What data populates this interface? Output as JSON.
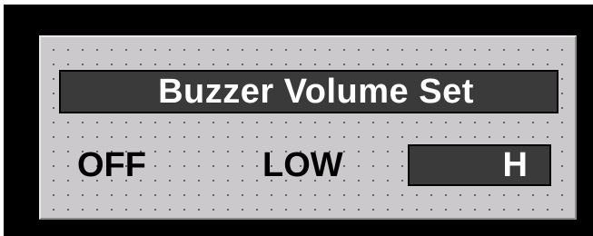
{
  "panel": {
    "title": "Buzzer Volume Set"
  },
  "options": [
    {
      "label": "OFF",
      "selected": false
    },
    {
      "label": "LOW",
      "selected": false
    },
    {
      "label": "H",
      "selected": true
    }
  ],
  "colors": {
    "frame": "#000000",
    "panel_bg": "#cbc9cc",
    "dark_fill": "#3a3a3a",
    "text_dark": "#000000",
    "text_light": "#ffffff"
  }
}
